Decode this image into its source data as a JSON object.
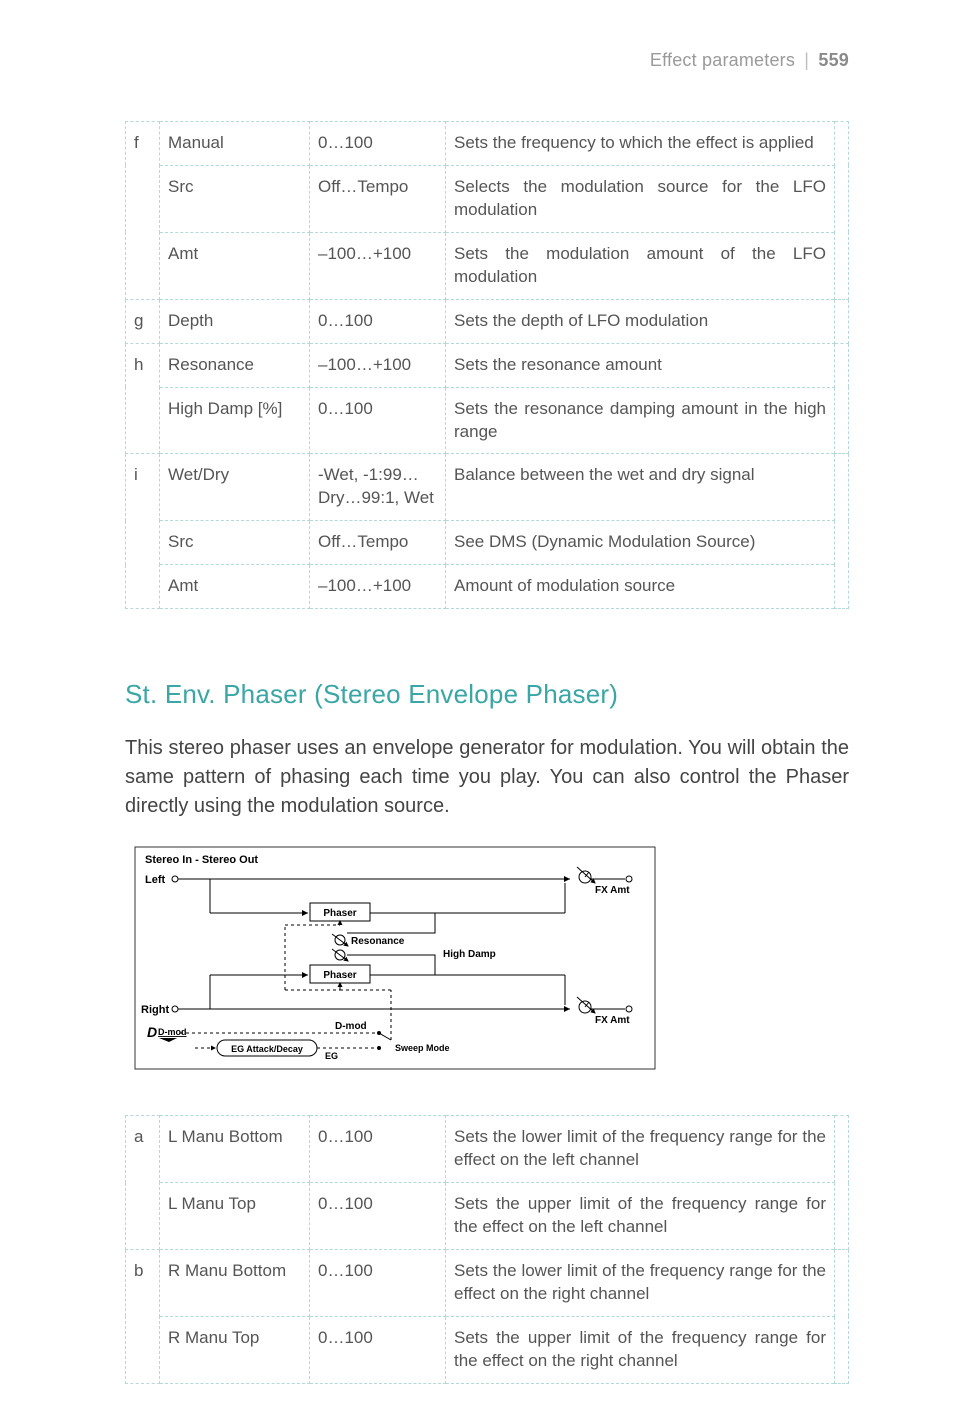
{
  "header": {
    "section": "Effect parameters",
    "page_number": "559"
  },
  "table1": {
    "rows": [
      {
        "lead": "f",
        "name": "Manual",
        "range": "0…100",
        "desc": "Sets the frequency to which the effect is applied"
      },
      {
        "lead": "",
        "name": "Src",
        "range": "Off…Tempo",
        "desc": "Selects the modulation source for the LFO modulation"
      },
      {
        "lead": "",
        "name": "Amt",
        "range": "–100…+100",
        "desc": "Sets the modulation amount of the LFO modulation"
      },
      {
        "lead": "g",
        "name": "Depth",
        "range": "0…100",
        "desc": "Sets the depth of LFO modulation"
      },
      {
        "lead": "h",
        "name": "Resonance",
        "range": "–100…+100",
        "desc": "Sets the resonance amount"
      },
      {
        "lead": "",
        "name": "High Damp [%]",
        "range": "0…100",
        "desc": "Sets the resonance damping amount in the high range"
      },
      {
        "lead": "i",
        "name": "Wet/Dry",
        "range": "-Wet, -1:99…Dry…99:1, Wet",
        "desc": "Balance between the wet and dry signal"
      },
      {
        "lead": "",
        "name": "Src",
        "range": "Off…Tempo",
        "desc": "See DMS (Dynamic Modulation Source)"
      },
      {
        "lead": "",
        "name": "Amt",
        "range": "–100…+100",
        "desc": "Amount of modulation source"
      }
    ]
  },
  "section": {
    "title": "St. Env. Phaser (Stereo Envelope Phaser)",
    "body": "This stereo phaser uses an envelope generator for modulation. You will obtain the same pattern of phasing each time you play. You can also control the Phaser directly using the modulation source."
  },
  "diagram": {
    "title": "Stereo In - Stereo Out",
    "left": "Left",
    "right": "Right",
    "phaser": "Phaser",
    "resonance": "Resonance",
    "high_damp": "High Damp",
    "fx_amt": "FX Amt",
    "dmod": "D-mod",
    "eg_attack_decay": "EG Attack/Decay",
    "eg": "EG",
    "sweep_mode": "Sweep Mode",
    "d_icon": "D"
  },
  "table2": {
    "rows": [
      {
        "lead": "a",
        "name": "L Manu Bottom",
        "range": "0…100",
        "desc": "Sets the lower limit of the frequency range for the effect on the left channel"
      },
      {
        "lead": "",
        "name": "L Manu Top",
        "range": "0…100",
        "desc": "Sets the upper limit of the frequency range for the effect on the left channel"
      },
      {
        "lead": "b",
        "name": "R Manu Bottom",
        "range": "0…100",
        "desc": "Sets the lower limit of the frequency range for the effect on the right channel"
      },
      {
        "lead": "",
        "name": "R Manu Top",
        "range": "0…100",
        "desc": "Sets the upper limit of the frequency range for the effect on the right channel"
      }
    ]
  }
}
